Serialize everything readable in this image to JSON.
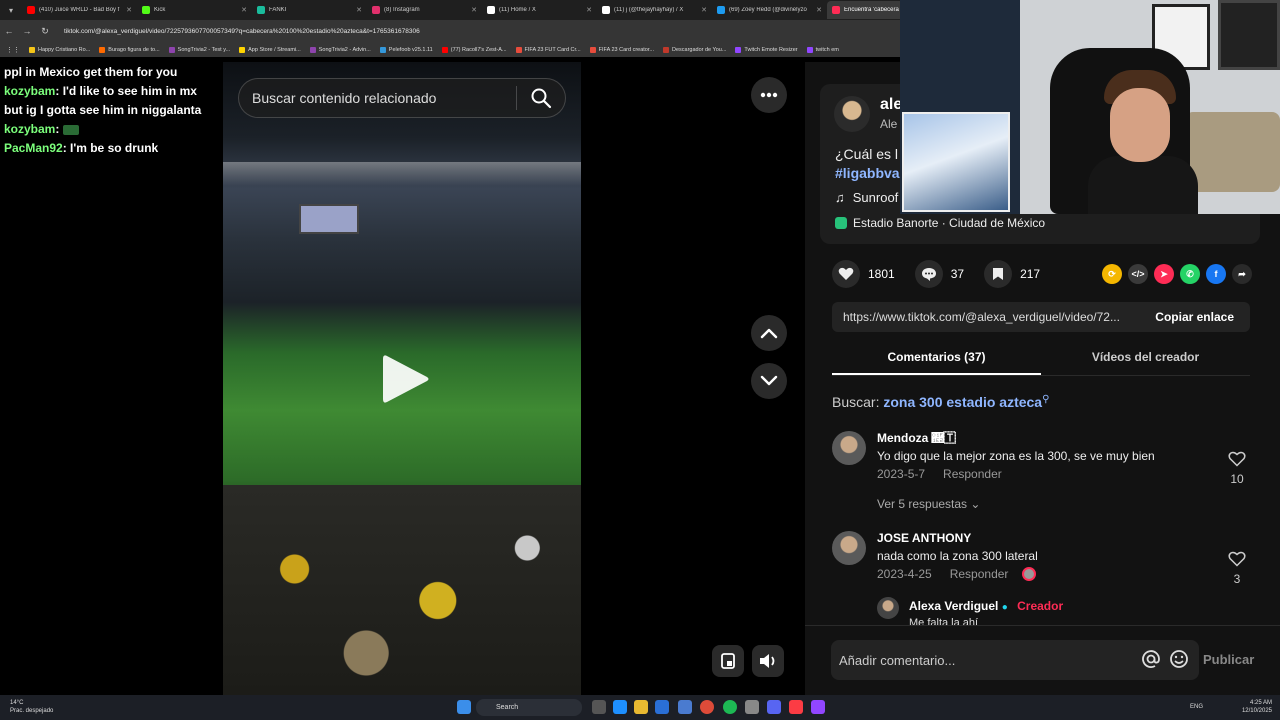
{
  "browser": {
    "tabs": [
      {
        "label": "(410) Juice WRLD - Bad Boy f",
        "color": "#ff0000"
      },
      {
        "label": "Kick",
        "color": "#53fc18"
      },
      {
        "label": "FANKI",
        "color": "#1abc9c"
      },
      {
        "label": "(8) Instagram",
        "color": "#e1306c"
      },
      {
        "label": "(11) Home / X",
        "color": "#ffffff"
      },
      {
        "label": "(11) j (@thejayhayhay) / X",
        "color": "#ffffff"
      },
      {
        "label": "(69) Zoey Redd (@divinelyzo",
        "color": "#1d9bf0"
      },
      {
        "label": "Encuentra 'cabecera 1",
        "color": "#fe2c55"
      }
    ],
    "url": "tiktok.com/@alexa_verdiguel/video/7225793607700057349?q=cabecera%20100%20estadio%20azteca&t=1765361678306",
    "bookmarks": [
      {
        "label": "Happy Cristiano Ro...",
        "color": "#f5c518"
      },
      {
        "label": "Burago figura de to...",
        "color": "#ff6a00"
      },
      {
        "label": "SongTrivia2 - Test y...",
        "color": "#8e44ad"
      },
      {
        "label": "App Store / Streami...",
        "color": "#ffd400"
      },
      {
        "label": "SongTrivia2 - Advin...",
        "color": "#8e44ad"
      },
      {
        "label": "Pelefoob v25.1.11",
        "color": "#3498db"
      },
      {
        "label": "(77) Racoll7's Zest-A...",
        "color": "#ff0000"
      },
      {
        "label": "FIFA 23 FUT Card Cr...",
        "color": "#e74c3c"
      },
      {
        "label": "FIFA 23 Card creator...",
        "color": "#e74c3c"
      },
      {
        "label": "Descargador de You...",
        "color": "#c0392b"
      },
      {
        "label": "Twitch Emote Resizer",
        "color": "#9146ff"
      },
      {
        "label": "twitch em",
        "color": "#9146ff"
      }
    ]
  },
  "chat": {
    "lines": [
      {
        "user": "",
        "text": "ppl in Mexico get them for you",
        "color": "#ffffff"
      },
      {
        "user": "kozybam",
        "text": ": I'd like to see him in mx but ig I gotta see him in niggalanta",
        "color": "#7cff7c"
      },
      {
        "user": "kozybam",
        "text": ":",
        "color": "#7cff7c",
        "emote": true
      },
      {
        "user": "PacMan92",
        "text": ": I'm be so drunk",
        "color": "#7cff7c"
      }
    ]
  },
  "video": {
    "search_placeholder": "Buscar contenido relacionado"
  },
  "post": {
    "username": "ale",
    "nickname": "Ale",
    "description": "¿Cuál es l",
    "hashtag": "#ligabbva",
    "music": "Sunroof",
    "location": "Estadio Banorte · Ciudad de México"
  },
  "actions": {
    "likes": "1801",
    "comments": "37",
    "saves": "217",
    "share_colors": [
      "#f5b700",
      "#3a3a3a",
      "#fe2c55",
      "#25d366",
      "#1877f2",
      "#2a2a2a"
    ]
  },
  "copy": {
    "link": "https://www.tiktok.com/@alexa_verdiguel/video/72...",
    "button": "Copiar enlace"
  },
  "tabs": {
    "comments": "Comentarios (37)",
    "creator_videos": "Vídeos del creador"
  },
  "related": {
    "label": "Buscar:",
    "query": "zona 300 estadio azteca"
  },
  "comments": [
    {
      "name": "Mendoza 🇢🇹",
      "text": "Yo digo que la mejor zona es la 300, se ve muy bien",
      "date": "2023-5-7",
      "reply": "Responder",
      "likes": "10"
    },
    {
      "name": "JOSE ANTHONY",
      "text": "nada como la zona 300 lateral",
      "date": "2023-4-25",
      "reply": "Responder",
      "likes": "3"
    }
  ],
  "replies_toggle": "Ver 5 respuestas",
  "reply": {
    "name": "Alexa Verdiguel",
    "badge": "Creador",
    "text": "Me falta la ahí"
  },
  "comment_bar": {
    "placeholder": "Añadir comentario...",
    "publish": "Publicar"
  },
  "taskbar": {
    "temp": "14°C",
    "weather": "Prac. despejado",
    "search": "Search",
    "lang": "ENG",
    "time": "4:25 AM",
    "date": "12/10/2025"
  }
}
